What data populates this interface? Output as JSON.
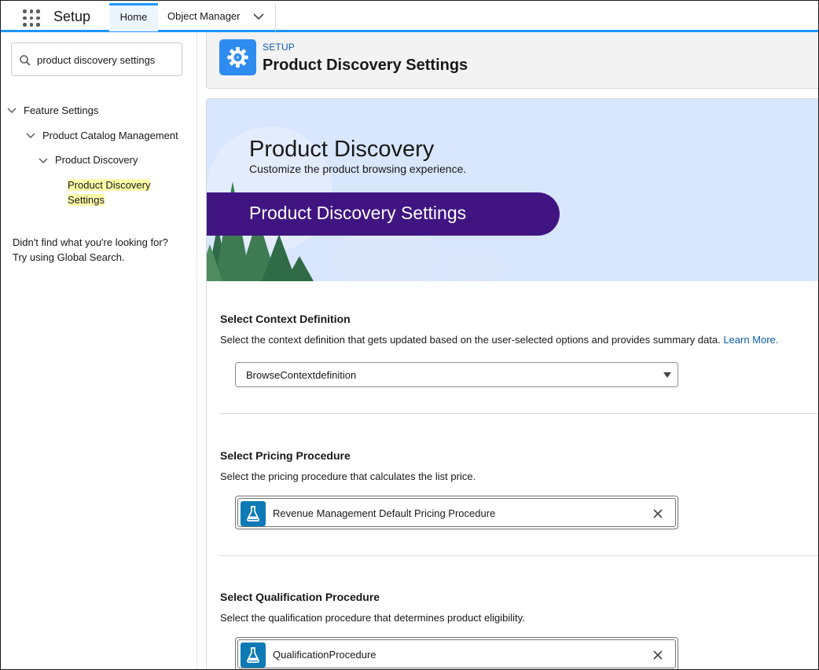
{
  "topbar": {
    "app_name": "Setup",
    "tabs": [
      {
        "label": "Home"
      },
      {
        "label": "Object Manager"
      }
    ]
  },
  "sidebar": {
    "search_value": "product discovery settings",
    "tree": [
      {
        "label": "Feature Settings"
      },
      {
        "label": "Product Catalog Management"
      },
      {
        "label": "Product Discovery"
      },
      {
        "label_line1": "Product Discovery",
        "label_line2": "Settings"
      }
    ],
    "help_line1": "Didn't find what you're looking for?",
    "help_line2": "Try using Global Search."
  },
  "header": {
    "eyebrow": "SETUP",
    "title": "Product Discovery Settings"
  },
  "banner": {
    "title": "Product Discovery",
    "subtitle": "Customize the product browsing experience.",
    "ribbon": "Product Discovery Settings"
  },
  "sections": {
    "context": {
      "title": "Select Context Definition",
      "description": "Select the context definition that gets updated based on the user-selected options and provides summary data.",
      "link": "Learn More.",
      "value": "BrowseContextdefinition"
    },
    "pricing": {
      "title": "Select Pricing Procedure",
      "description": "Select the pricing procedure that calculates the list price.",
      "value": "Revenue Management Default Pricing Procedure"
    },
    "qualification": {
      "title": "Select Qualification Procedure",
      "description": "Select the qualification procedure that determines product eligibility.",
      "value": "QualificationProcedure"
    }
  },
  "colors": {
    "brand_blue": "#1b96ff",
    "ribbon_purple": "#401582",
    "banner_bg": "#d8e6fe",
    "highlight": "#fefca8",
    "procedure_icon_bg": "#0d7ab6"
  },
  "icons": [
    "app-launcher-icon",
    "chevron-down-icon",
    "search-icon",
    "settings-gear-icon",
    "flask-icon",
    "close-icon",
    "dropdown-caret-icon"
  ]
}
